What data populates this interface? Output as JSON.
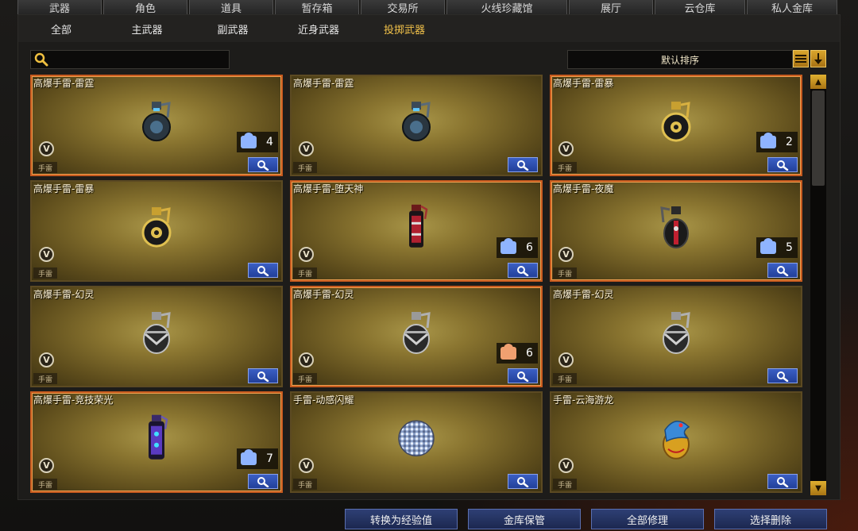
{
  "top_tabs": [
    {
      "label": "武器",
      "style": "active"
    },
    {
      "label": "角色",
      "style": ""
    },
    {
      "label": "道具",
      "style": ""
    },
    {
      "label": "暂存箱",
      "style": ""
    },
    {
      "label": "交易所",
      "style": ""
    },
    {
      "label": "火线珍藏馆",
      "style": "special"
    },
    {
      "label": "展厅",
      "style": ""
    },
    {
      "label": "云仓库",
      "style": "blue"
    },
    {
      "label": "私人金库",
      "style": "blue"
    }
  ],
  "sub_tabs": [
    {
      "label": "全部",
      "active": false
    },
    {
      "label": "主武器",
      "active": false
    },
    {
      "label": "副武器",
      "active": false
    },
    {
      "label": "近身武器",
      "active": false
    },
    {
      "label": "投掷武器",
      "active": true
    }
  ],
  "search": {
    "placeholder": ""
  },
  "sort": {
    "label": "默认排序"
  },
  "colors": {
    "accent_gold": "#f2c24a",
    "button_blue": "#2a48a4",
    "card_gold": "#8a7530",
    "highlight_border": "#c65a1e"
  },
  "items": [
    {
      "name": "高爆手雷-雷霆",
      "type": "手雷",
      "count": "4",
      "count_icon": "blue",
      "glow": true,
      "icon": "grenade-dark-icon"
    },
    {
      "name": "高爆手雷-雷霆",
      "type": "手雷",
      "count": "",
      "count_icon": "",
      "glow": false,
      "icon": "grenade-dark-icon"
    },
    {
      "name": "高爆手雷-雷暴",
      "type": "手雷",
      "count": "2",
      "count_icon": "blue",
      "glow": true,
      "icon": "grenade-gold-icon"
    },
    {
      "name": "高爆手雷-雷暴",
      "type": "手雷",
      "count": "",
      "count_icon": "",
      "glow": false,
      "icon": "grenade-gold-icon"
    },
    {
      "name": "高爆手雷-堕天神",
      "type": "手雷",
      "count": "6",
      "count_icon": "blue",
      "glow": true,
      "icon": "grenade-red-icon"
    },
    {
      "name": "高爆手雷-夜魔",
      "type": "手雷",
      "count": "5",
      "count_icon": "blue",
      "glow": true,
      "icon": "grenade-night-icon"
    },
    {
      "name": "高爆手雷-幻灵",
      "type": "手雷",
      "count": "",
      "count_icon": "",
      "glow": false,
      "icon": "grenade-silver-icon"
    },
    {
      "name": "高爆手雷-幻灵",
      "type": "手雷",
      "count": "6",
      "count_icon": "orange",
      "glow": true,
      "icon": "grenade-silver-icon"
    },
    {
      "name": "高爆手雷-幻灵",
      "type": "手雷",
      "count": "",
      "count_icon": "",
      "glow": false,
      "icon": "grenade-silver-icon"
    },
    {
      "name": "高爆手雷-竞技荣光",
      "type": "手雷",
      "count": "7",
      "count_icon": "blue",
      "glow": true,
      "icon": "grenade-purple-icon"
    },
    {
      "name": "手雷-动感闪耀",
      "type": "手雷",
      "count": "",
      "count_icon": "",
      "glow": false,
      "icon": "disco-ball-icon"
    },
    {
      "name": "手雷-云海游龙",
      "type": "手雷",
      "count": "",
      "count_icon": "",
      "glow": false,
      "icon": "dragon-grenade-icon"
    }
  ],
  "bottom_buttons": [
    "转换为经验值",
    "金库保管",
    "全部修理",
    "选择删除"
  ]
}
